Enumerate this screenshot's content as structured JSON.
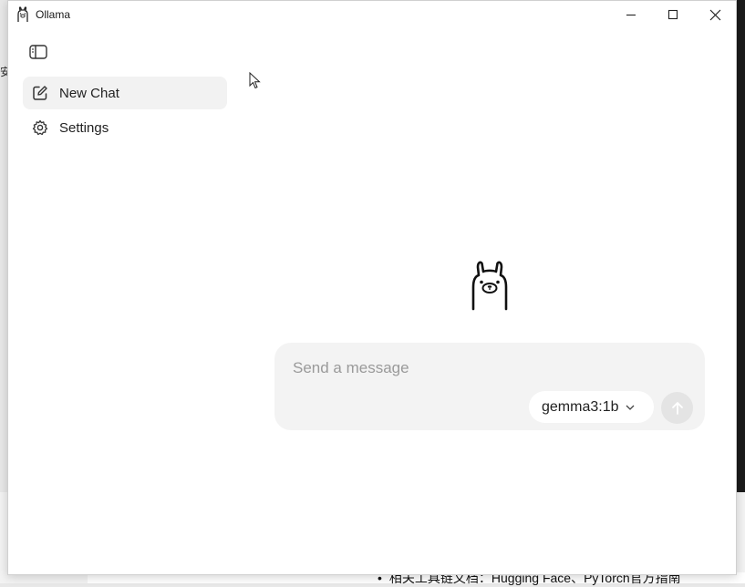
{
  "window": {
    "title": "Ollama"
  },
  "sidebar": {
    "items": [
      {
        "label": "New Chat",
        "icon": "edit-square-icon",
        "active": true
      },
      {
        "label": "Settings",
        "icon": "gear-icon",
        "active": false
      }
    ]
  },
  "composer": {
    "placeholder": "Send a message",
    "value": "",
    "model": "gemma3:1b",
    "send_icon": "arrow-up-icon"
  },
  "background": {
    "bottom_text": "相关工具链文档：Hugging Face、PyTorch官方指南",
    "bullet": "•",
    "left_glyph": "安"
  },
  "colors": {
    "sidebar_active": "#f2f2f2",
    "composer_bg": "#f3f3f3",
    "send_disabled": "#e4e4e4"
  }
}
